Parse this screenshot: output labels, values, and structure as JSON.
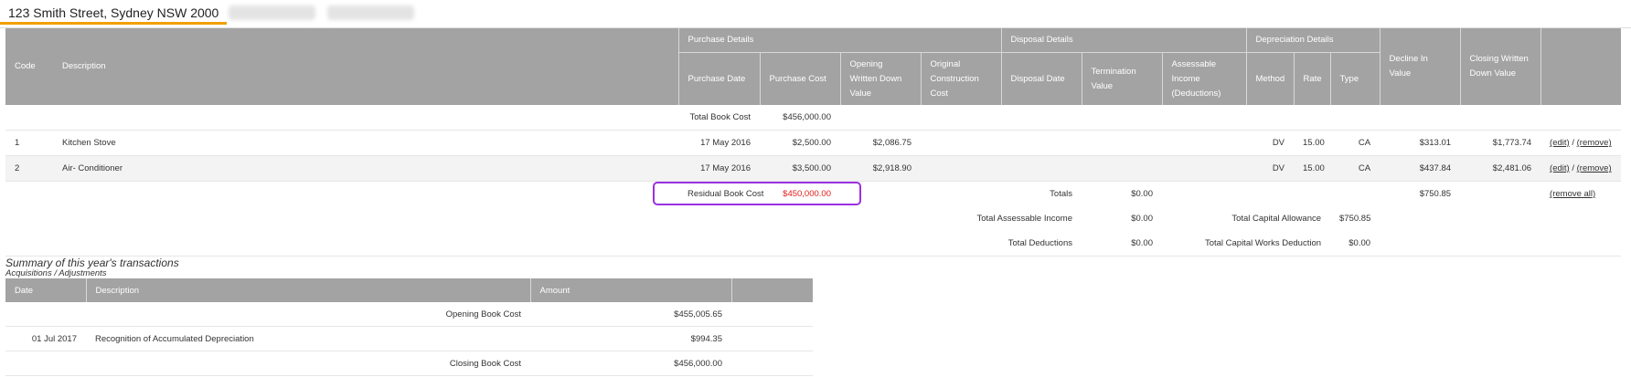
{
  "tabs": {
    "active": "123 Smith Street, Sydney NSW 2000"
  },
  "main_table": {
    "groups": {
      "purchase": "Purchase Details",
      "disposal": "Disposal Details",
      "depreciation": "Depreciation Details"
    },
    "headers": {
      "code": "Code",
      "description": "Description",
      "purchase_date": "Purchase Date",
      "purchase_cost": "Purchase Cost",
      "opening_wdv": "Opening Written Down Value",
      "original_construction": "Original Construction Cost",
      "disposal_date": "Disposal Date",
      "termination": "Termination Value",
      "assessable": "Assessable Income (Deductions)",
      "method": "Method",
      "rate": "Rate",
      "type": "Type",
      "decline": "Decline In Value",
      "closing_wdv": "Closing Written Down Value"
    },
    "total_book_cost_label": "Total Book Cost",
    "total_book_cost_value": "$456,000.00",
    "rows": [
      {
        "code": "1",
        "description": "Kitchen Stove",
        "purchase_date": "17 May 2016",
        "purchase_cost": "$2,500.00",
        "opening_wdv": "$2,086.75",
        "method": "DV",
        "rate": "15.00",
        "type": "CA",
        "decline": "$313.01",
        "closing_wdv": "$1,773.74",
        "edit": "(edit)",
        "sep": " / ",
        "remove": "(remove)"
      },
      {
        "code": "2",
        "description": "Air- Conditioner",
        "purchase_date": "17 May 2016",
        "purchase_cost": "$3,500.00",
        "opening_wdv": "$2,918.90",
        "method": "DV",
        "rate": "15.00",
        "type": "CA",
        "decline": "$437.84",
        "closing_wdv": "$2,481.06",
        "edit": "(edit)",
        "sep": " / ",
        "remove": "(remove)"
      }
    ],
    "residual_label": "Residual Book Cost",
    "residual_value": "$450,000.00",
    "totals_label": "Totals",
    "totals_value": "$0.00",
    "totals_decline": "$750.85",
    "remove_all": "(remove all)",
    "total_assessable_label": "Total Assessable Income",
    "total_assessable_value": "$0.00",
    "total_capital_allowance_label": "Total Capital Allowance",
    "total_capital_allowance_value": "$750.85",
    "total_deductions_label": "Total Deductions",
    "total_deductions_value": "$0.00",
    "total_capital_works_label": "Total Capital Works Deduction",
    "total_capital_works_value": "$0.00"
  },
  "summary": {
    "title": "Summary of this year's transactions",
    "subtitle": "Acquisitions / Adjustments",
    "headers": {
      "date": "Date",
      "description": "Description",
      "amount": "Amount"
    },
    "opening_label": "Opening Book Cost",
    "opening_value": "$455,005.65",
    "rows": [
      {
        "date": "01 Jul 2017",
        "description": "Recognition of Accumulated Depreciation",
        "amount": "$994.35"
      }
    ],
    "closing_label": "Closing Book Cost",
    "closing_value": "$456,000.00"
  },
  "colors": {
    "header_bg": "#a3a3a3",
    "tab_accent": "#f0a000",
    "highlight": "#9b30e0",
    "negative": "#e31b1b"
  }
}
